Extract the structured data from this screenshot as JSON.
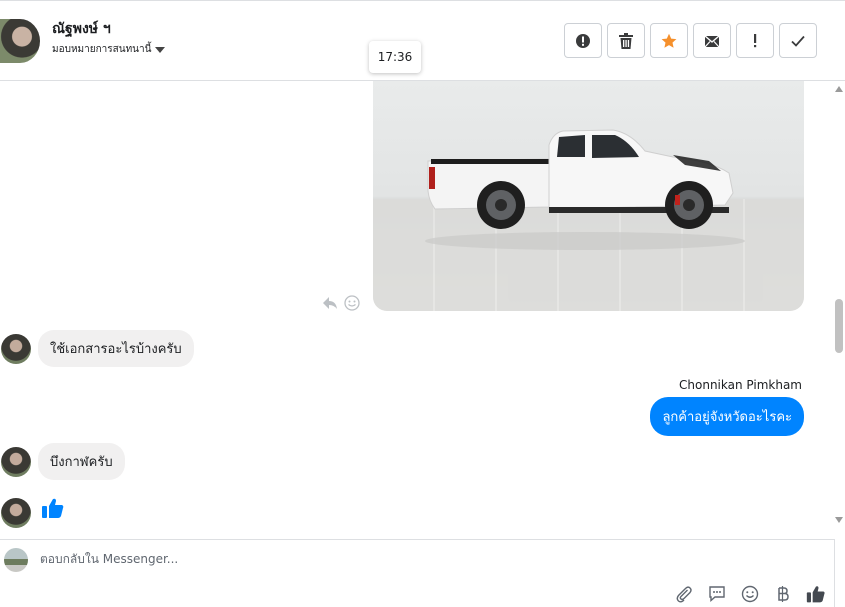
{
  "header": {
    "contact_name": "ณัฐพงษ์ ฯ",
    "assign_label": "มอบหมายการสนทนานี้",
    "time_tooltip": "17:36",
    "toolbar": [
      {
        "name": "spam-button",
        "icon": "alert-circle-icon"
      },
      {
        "name": "delete-button",
        "icon": "trash-icon"
      },
      {
        "name": "star-button",
        "icon": "star-icon",
        "color": "#f5902c"
      },
      {
        "name": "mark-unread-button",
        "icon": "envelope-icon"
      },
      {
        "name": "follow-up-button",
        "icon": "exclamation-icon"
      },
      {
        "name": "done-button",
        "icon": "checkmark-icon"
      }
    ]
  },
  "messages": [
    {
      "type": "image",
      "direction": "incoming",
      "alt": "white pickup truck"
    },
    {
      "type": "text",
      "direction": "incoming",
      "text": "ใช้เอกสารอะไรบ้างครับ"
    },
    {
      "type": "text",
      "direction": "outgoing",
      "sender": "Chonnikan Pimkham",
      "text": "ลูกค้าอยู่จังหวัดอะไรคะ"
    },
    {
      "type": "text",
      "direction": "incoming",
      "text": "บึงกาฬครับ"
    },
    {
      "type": "like",
      "direction": "incoming",
      "icon": "thumbs-up-icon"
    }
  ],
  "composer": {
    "placeholder": "ตอบกลับใน Messenger...",
    "tools": [
      "paperclip-icon",
      "saved-replies-icon",
      "emoji-icon",
      "baht-icon",
      "thumbs-up-icon"
    ]
  },
  "colors": {
    "accent": "#0084ff",
    "star": "#f5902c",
    "incoming_bubble": "#f1f0f0"
  }
}
